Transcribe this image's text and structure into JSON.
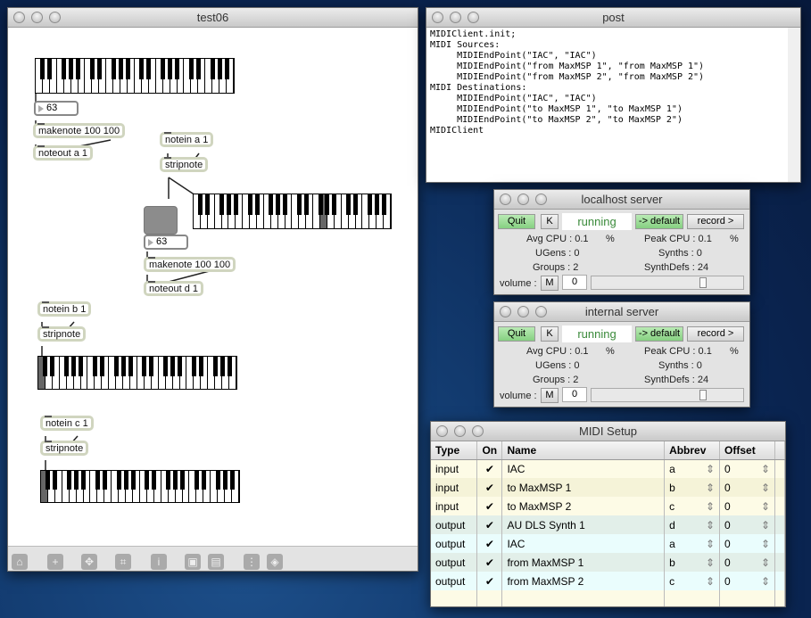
{
  "patch": {
    "title": "test06",
    "number1": "63",
    "number2": "63",
    "objects": {
      "makenote1": "makenote 100 100",
      "noteout_a": "noteout a 1",
      "notein_a": "notein a 1",
      "stripnote1": "stripnote",
      "makenote2": "makenote 100 100",
      "noteout_d": "noteout d 1",
      "notein_b": "notein b 1",
      "stripnote2": "stripnote",
      "notein_c": "notein c 1",
      "stripnote3": "stripnote"
    },
    "toolbar": [
      "lock-icon",
      "add-icon",
      "move-icon",
      "presentation-icon",
      "info-icon",
      "front-icon",
      "back-icon",
      "grid-icon",
      "snap-icon"
    ]
  },
  "post": {
    "title": "post",
    "lines": [
      "MIDIClient.init;",
      "MIDI Sources:",
      "     MIDIEndPoint(\"IAC\", \"IAC\")",
      "     MIDIEndPoint(\"from MaxMSP 1\", \"from MaxMSP 1\")",
      "     MIDIEndPoint(\"from MaxMSP 2\", \"from MaxMSP 2\")",
      "MIDI Destinations:",
      "     MIDIEndPoint(\"IAC\", \"IAC\")",
      "     MIDIEndPoint(\"to MaxMSP 1\", \"to MaxMSP 1\")",
      "     MIDIEndPoint(\"to MaxMSP 2\", \"to MaxMSP 2\")",
      "MIDIClient"
    ]
  },
  "servers": [
    {
      "title": "localhost server",
      "quit": "Quit",
      "k": "K",
      "status": "running",
      "default": "-> default",
      "record": "record >",
      "avg_cpu": "Avg CPU : 0.1",
      "pct": "%",
      "peak_cpu": "Peak CPU : 0.1",
      "ugens": "UGens : 0",
      "synths": "Synths : 0",
      "groups": "Groups : 2",
      "synthdefs": "SynthDefs : 24",
      "volume_label": "volume :",
      "mute": "M",
      "volume": "0",
      "volume_slider": 0.75
    },
    {
      "title": "internal server",
      "quit": "Quit",
      "k": "K",
      "status": "running",
      "default": "-> default",
      "record": "record >",
      "avg_cpu": "Avg CPU : 0.1",
      "pct": "%",
      "peak_cpu": "Peak CPU : 0.1",
      "ugens": "UGens : 0",
      "synths": "Synths : 0",
      "groups": "Groups : 2",
      "synthdefs": "SynthDefs : 24",
      "volume_label": "volume :",
      "mute": "M",
      "volume": "0",
      "volume_slider": 0.75
    }
  ],
  "midi": {
    "title": "MIDI Setup",
    "headers": [
      "Type",
      "On",
      "Name",
      "Abbrev",
      "Offset"
    ],
    "rows": [
      [
        "input",
        "✔",
        "IAC",
        "a",
        "0"
      ],
      [
        "input",
        "✔",
        "to MaxMSP 1",
        "b",
        "0"
      ],
      [
        "input",
        "✔",
        "to MaxMSP 2",
        "c",
        "0"
      ],
      [
        "output",
        "✔",
        "AU DLS Synth 1",
        "d",
        "0"
      ],
      [
        "output",
        "✔",
        "IAC",
        "a",
        "0"
      ],
      [
        "output",
        "✔",
        "from MaxMSP 1",
        "b",
        "0"
      ],
      [
        "output",
        "✔",
        "from MaxMSP 2",
        "c",
        "0"
      ]
    ]
  }
}
